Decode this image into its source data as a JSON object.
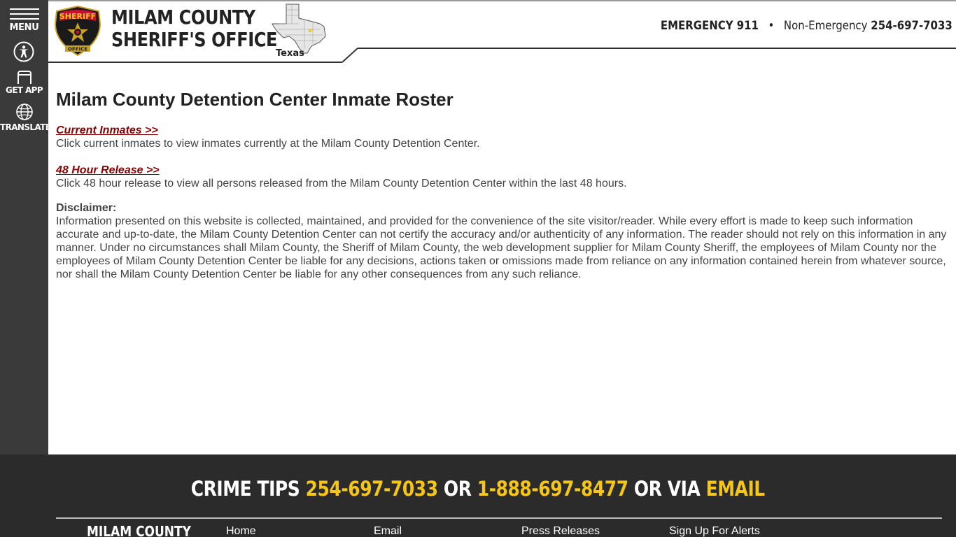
{
  "sidebar": {
    "menu_label": "MENU",
    "getapp_label": "GET APP",
    "translate_label": "TRANSLATE"
  },
  "header": {
    "badge_text": "SHERIFF",
    "badge_sub": "OFFICE",
    "brand_line1": "MILAM COUNTY",
    "brand_line2": "SHERIFF'S OFFICE",
    "state_label": "Texas",
    "emergency": "EMERGENCY 911",
    "separator": "•",
    "non_emergency_label": "Non-Emergency",
    "non_emergency_phone": "254-697-7033"
  },
  "main": {
    "title": "Milam County Detention Center Inmate Roster",
    "current_link": "Current Inmates >>",
    "current_desc": "Click current inmates to view inmates currently at the Milam County Detention Center.",
    "release_link": "48 Hour Release >>",
    "release_desc": "Click 48 hour release to view all persons released from the Milam County Detention Center within the last 48 hours.",
    "disclaimer_title": "Disclaimer:",
    "disclaimer_text": "Information presented on this website is collected, maintained, and provided for the convenience of the site visitor/reader. While every effort is made to keep such information accurate and up-to-date, the Milam County Detention Center can not certify the accuracy and/or authenticity of any information. The reader should not rely on this information in any manner.  Under no circumstances shall Milam County, the Sheriff of Milam County, the web development supplier for Milam County Sheriff, the employees of Milam County nor the employees of Milam County Detention Center be liable for any decisions, actions taken or omissions made from reliance on any information contained herein from whatever source, nor shall the Milam County Detention Center be liable for any other consequences from any such reliance."
  },
  "footer": {
    "tips_label": "CRIME TIPS",
    "tips_phone1": "254-697-7033",
    "or1": "OR",
    "tips_phone2": "1-888-697-8477",
    "or_via": "OR VIA",
    "tips_email": "EMAIL",
    "brand": "MILAM COUNTY",
    "links": [
      "Home",
      "Email",
      "Press Releases",
      "Sign Up For Alerts"
    ]
  },
  "colors": {
    "sidebar": "#3a3a3a",
    "footer": "#2b2b2b",
    "link": "#8b0000",
    "accent_yellow": "#f5c518"
  }
}
